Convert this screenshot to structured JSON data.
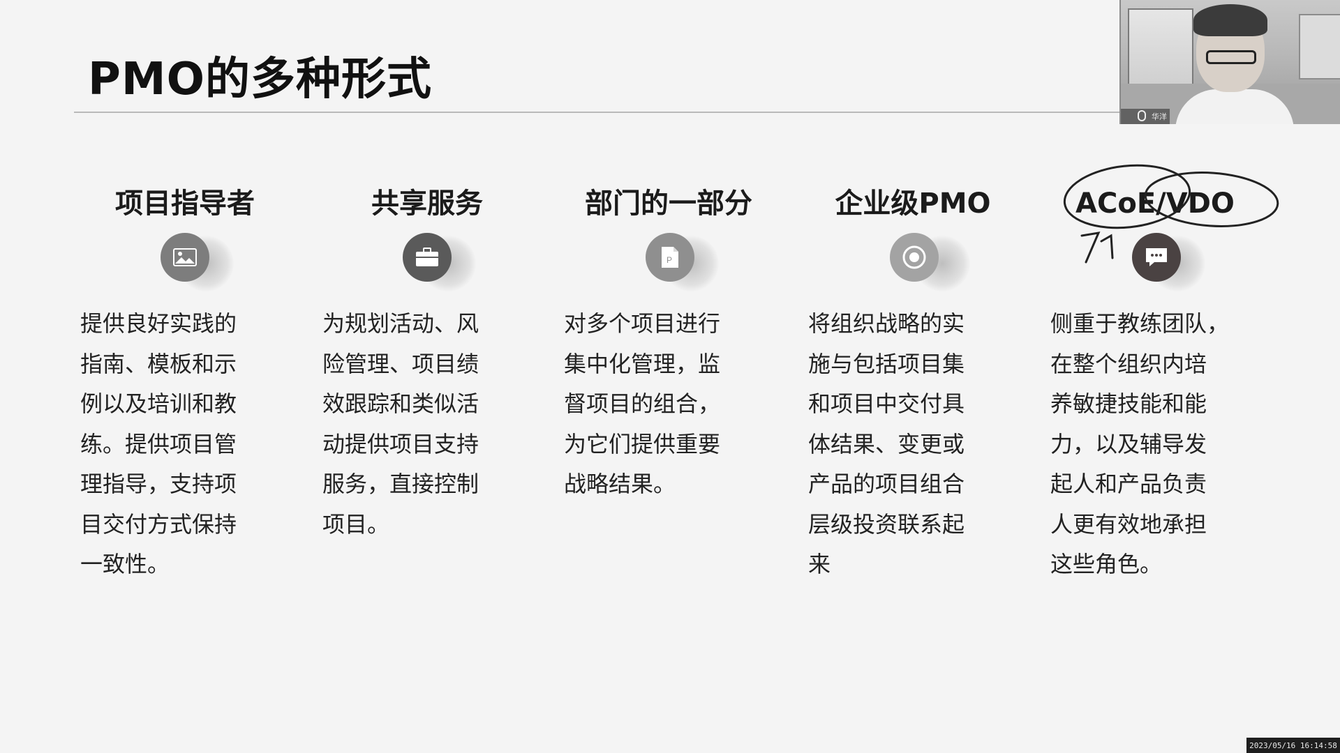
{
  "slide": {
    "title": "PMO的多种形式",
    "columns": [
      {
        "heading": "项目指导者",
        "icon": "image-icon",
        "icon_color": "#7d7d7d",
        "description": "提供良好实践的\n指南、模板和示\n例以及培训和教\n练。提供项目管\n理指导，支持项\n目交付方式保持\n一致性。"
      },
      {
        "heading": "共享服务",
        "icon": "briefcase-icon",
        "icon_color": "#5a5a5a",
        "description": "为规划活动、风\n险管理、项目绩\n效跟踪和类似活\n动提供项目支持\n服务，直接控制\n项目。"
      },
      {
        "heading": "部门的一部分",
        "icon": "document-icon",
        "icon_color": "#8f8f8f",
        "description": "对多个项目进行\n集中化管理，监\n督项目的组合，\n为它们提供重要\n战略结果。"
      },
      {
        "heading": "企业级PMO",
        "icon": "target-icon",
        "icon_color": "#a3a3a3",
        "description": "将组织战略的实\n施与包括项目集\n和项目中交付具\n体结果、变更或\n产品的项目组合\n层级投资联系起\n来"
      },
      {
        "heading": "ACoE/VDO",
        "icon": "chat-icon",
        "icon_color": "#4a4242",
        "description": "侧重于教练团队，\n在整个组织内培\n养敏捷技能和能\n力，以及辅导发\n起人和产品负责\n人更有效地承担\n这些角色。"
      }
    ]
  },
  "webcam": {
    "name_label": "华洋"
  },
  "timestamp": "2023/05/16 16:14:58"
}
